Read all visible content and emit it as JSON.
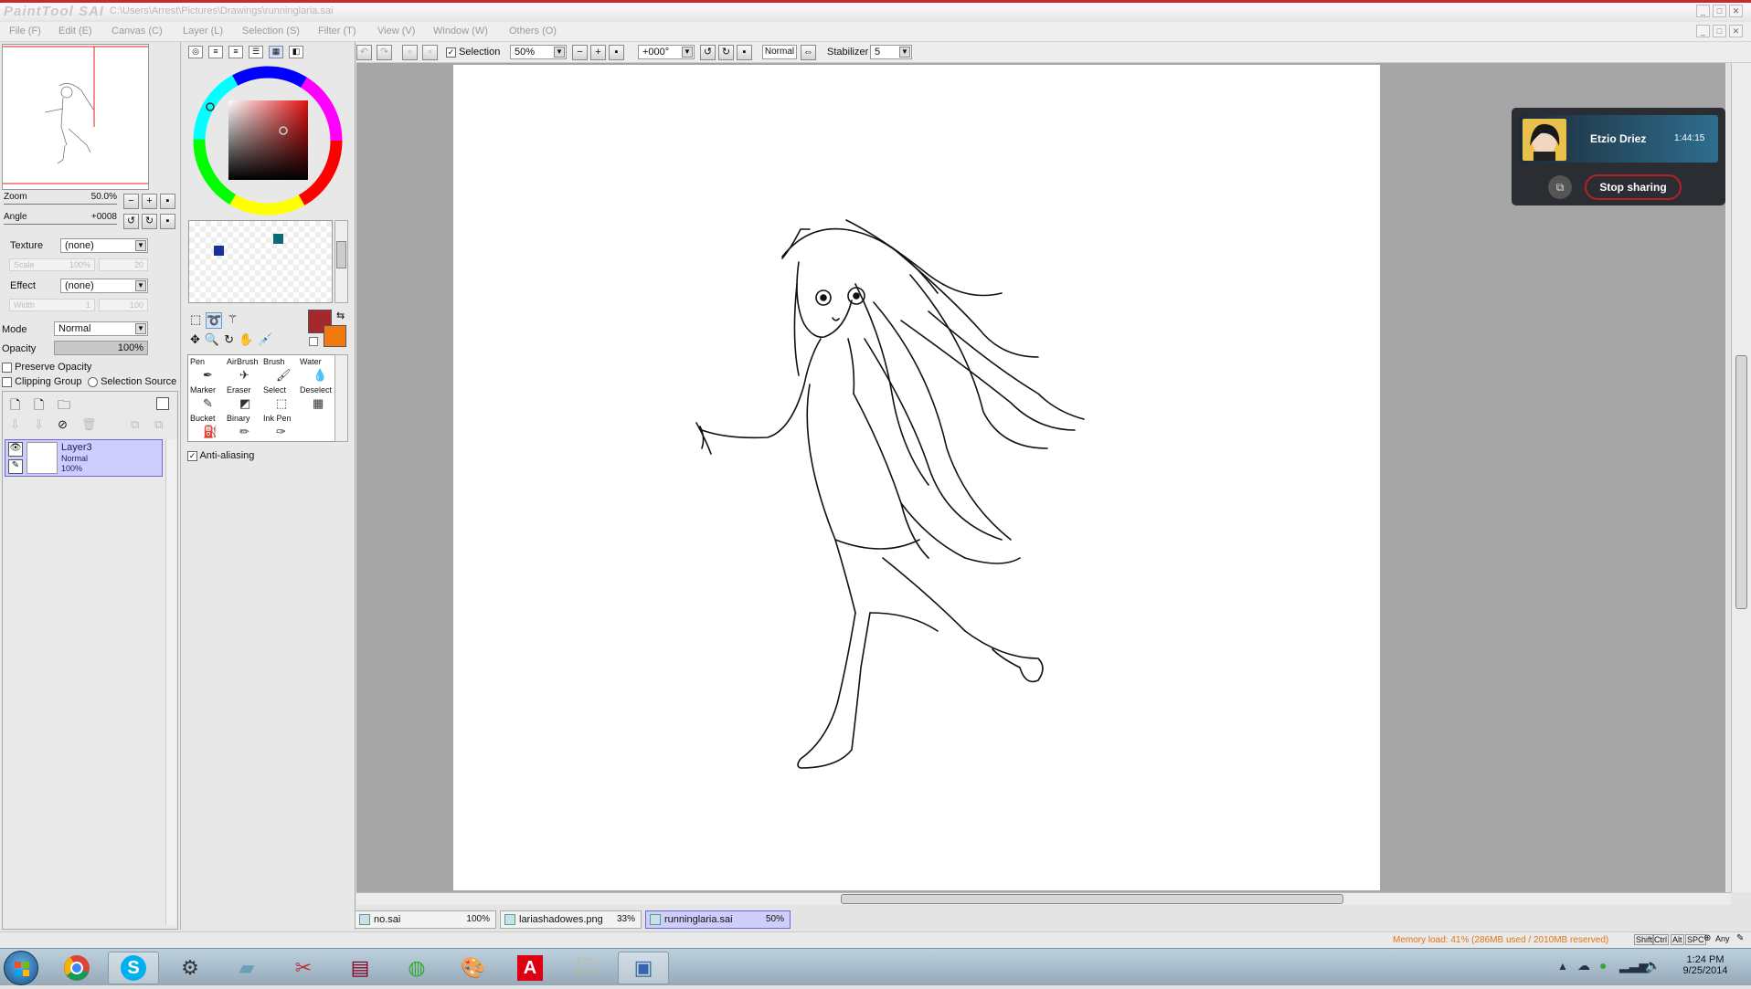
{
  "window": {
    "title": "C:\\Users\\Arrest\\Pictures\\Drawings\\runninglaria.sai",
    "logo": "PaintTool SAI"
  },
  "menu": [
    "File (F)",
    "Edit (E)",
    "Canvas (C)",
    "Layer (L)",
    "Selection (S)",
    "Filter (T)",
    "View (V)",
    "Window (W)",
    "Others (O)"
  ],
  "navigator": {
    "zoom_label": "Zoom",
    "zoom_value": "50.0%",
    "angle_label": "Angle",
    "angle_value": "+0008"
  },
  "texture": {
    "label": "Texture",
    "value": "(none)",
    "scale_label": "Scale",
    "scale_value": "100%",
    "scale_num": "20"
  },
  "effect": {
    "label": "Effect",
    "value": "(none)",
    "width_label": "Width",
    "width_value": "1",
    "width_num": "100"
  },
  "mode": {
    "label": "Mode",
    "value": "Normal"
  },
  "opacity": {
    "label": "Opacity",
    "value": "100%"
  },
  "checks": {
    "preserve_opacity": "Preserve Opacity",
    "clipping_group": "Clipping Group",
    "selection_source": "Selection Source"
  },
  "layer": {
    "name": "Layer3",
    "mode": "Normal",
    "opacity": "100%"
  },
  "tools": [
    {
      "label": "Pen",
      "icon": "pen-icon"
    },
    {
      "label": "AirBrush",
      "icon": "airbrush-icon"
    },
    {
      "label": "Brush",
      "icon": "brush-icon"
    },
    {
      "label": "Water",
      "icon": "water-icon"
    },
    {
      "label": "Marker",
      "icon": "marker-icon"
    },
    {
      "label": "Eraser",
      "icon": "eraser-icon"
    },
    {
      "label": "Select",
      "icon": "select-icon"
    },
    {
      "label": "Deselect",
      "icon": "deselect-icon"
    },
    {
      "label": "Bucket",
      "icon": "bucket-icon"
    },
    {
      "label": "Binary",
      "icon": "binary-icon"
    },
    {
      "label": "Ink Pen",
      "icon": "ink-pen-icon"
    }
  ],
  "anti_aliasing": "Anti-aliasing",
  "toolbar": {
    "selection_label": "Selection",
    "zoom": "50%",
    "angle": "+000°",
    "blend": "Normal",
    "stabilizer_label": "Stabilizer",
    "stabilizer_value": "5"
  },
  "colors": {
    "primary": "#a5282c",
    "secondary": "#f07a10",
    "swatch1": "#1a2f9a",
    "swatch2": "#0b6a73"
  },
  "tabs": [
    {
      "name": "no.sai",
      "pct": "100%"
    },
    {
      "name": "lariashadowes.png",
      "pct": "33%"
    },
    {
      "name": "runninglaria.sai",
      "pct": "50%"
    }
  ],
  "status": {
    "memory": "Memory load: 41% (286MB used / 2010MB reserved)",
    "keys": [
      "Shift",
      "Ctrl",
      "Alt",
      "SPC"
    ],
    "any": "Any"
  },
  "share": {
    "name": "Etzio Driez",
    "time": "1:44:15",
    "button": "Stop sharing"
  },
  "clock": {
    "time": "1:24 PM",
    "date": "9/25/2014"
  },
  "taskbar": [
    "start",
    "chrome",
    "skype",
    "steam",
    "app",
    "scissors",
    "winrar",
    "maps",
    "paint",
    "adobe",
    "explorer",
    "sai"
  ]
}
